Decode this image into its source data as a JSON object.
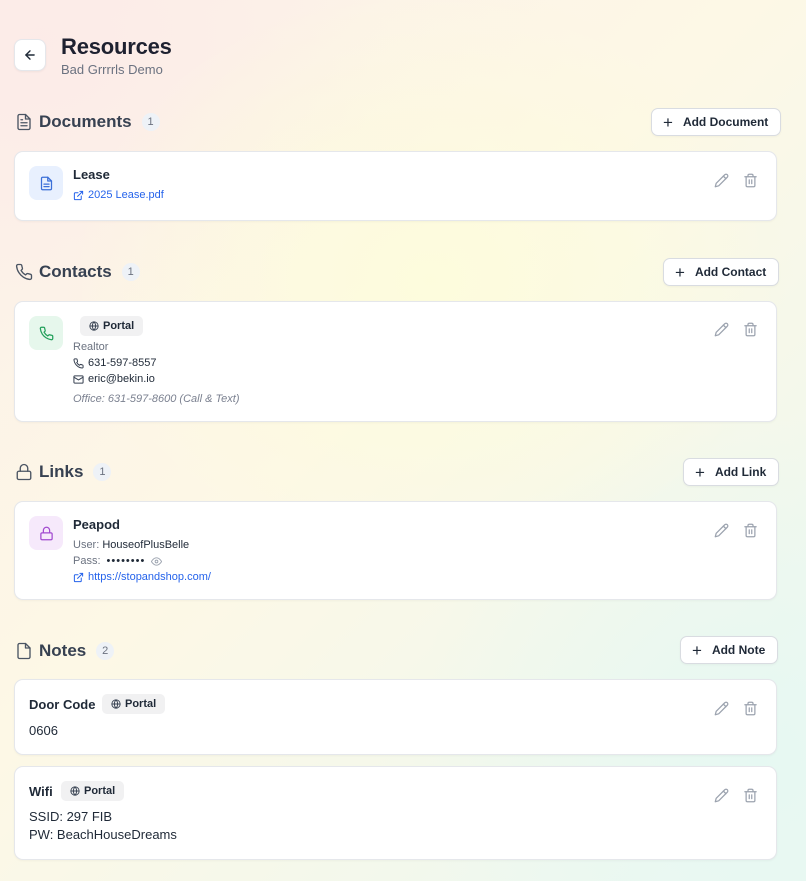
{
  "header": {
    "title": "Resources",
    "subtitle": "Bad Grrrrls Demo"
  },
  "documents": {
    "title": "Documents",
    "count": "1",
    "add_label": "Add Document",
    "items": [
      {
        "title": "Lease",
        "file": "2025 Lease.pdf"
      }
    ]
  },
  "contacts": {
    "title": "Contacts",
    "count": "1",
    "add_label": "Add Contact",
    "items": [
      {
        "badge": "Portal",
        "role": "Realtor",
        "phone": "631-597-8557",
        "email": "eric@bekin.io",
        "note": "Office: 631-597-8600 (Call & Text)"
      }
    ]
  },
  "links": {
    "title": "Links",
    "count": "1",
    "add_label": "Add Link",
    "items": [
      {
        "title": "Peapod",
        "user_label": "User:",
        "user": "HouseofPlusBelle",
        "pass_label": "Pass:",
        "pass": "••••••••",
        "url": "https://stopandshop.com/"
      }
    ]
  },
  "notes": {
    "title": "Notes",
    "count": "2",
    "add_label": "Add Note",
    "items": [
      {
        "title": "Door Code",
        "badge": "Portal",
        "line1": "0606",
        "line2": ""
      },
      {
        "title": "Wifi",
        "badge": "Portal",
        "line1": "SSID: 297 FIB",
        "line2": "PW: BeachHouseDreams"
      }
    ]
  },
  "icons": {
    "back": "arrow-left-icon",
    "document": "file-text-icon",
    "contact": "phone-icon",
    "link": "lock-icon",
    "note": "file-icon",
    "edit": "pencil-icon",
    "delete": "trash-icon",
    "external": "external-link-icon",
    "globe": "globe-icon",
    "mail": "mail-icon",
    "eye": "eye-icon"
  },
  "colors": {
    "link_blue": "#2563eb",
    "doc_tile": "#e8f0fe",
    "contact_tile": "#e6f7ec",
    "link_tile": "#f6e9fb"
  }
}
